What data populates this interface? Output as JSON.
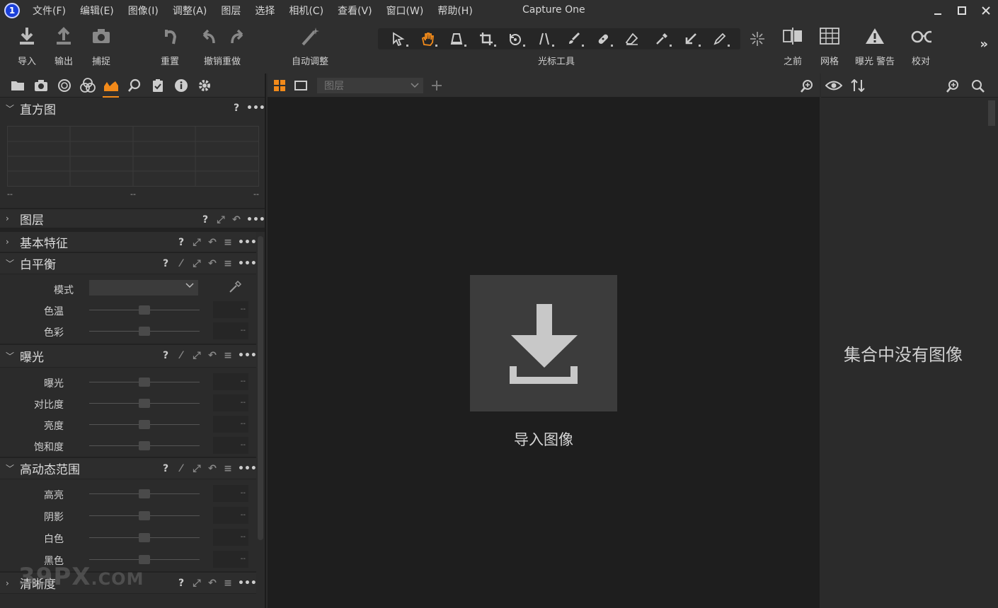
{
  "app": {
    "title": "Capture One",
    "logo_text": "1"
  },
  "menu": [
    "文件(F)",
    "编辑(E)",
    "图像(I)",
    "调整(A)",
    "图层",
    "选择",
    "相机(C)",
    "查看(V)",
    "窗口(W)",
    "帮助(H)"
  ],
  "toolbar": {
    "import": "导入",
    "export": "输出",
    "capture": "捕捉",
    "reset": "重置",
    "undo_redo": "撤销重做",
    "auto_adjust": "自动调整",
    "cursor_tools": "光标工具",
    "before": "之前",
    "grid": "网格",
    "exposure_warning": "曝光 警告",
    "proof": "校对",
    "more": "»"
  },
  "colors": {
    "accent": "#f28a1a",
    "background": "#2b2b2b",
    "viewer": "#1e1e1e"
  },
  "left": {
    "histogram": {
      "title": "直方图",
      "vals": [
        "--",
        "--",
        "--"
      ]
    },
    "layers": {
      "title": "图层"
    },
    "basic": {
      "title": "基本特征"
    },
    "white_balance": {
      "title": "白平衡",
      "mode_label": "模式",
      "rows": [
        {
          "label": "色温",
          "value": "--"
        },
        {
          "label": "色彩",
          "value": "--"
        }
      ]
    },
    "exposure": {
      "title": "曝光",
      "rows": [
        {
          "label": "曝光",
          "value": "--"
        },
        {
          "label": "对比度",
          "value": "--"
        },
        {
          "label": "亮度",
          "value": "--"
        },
        {
          "label": "饱和度",
          "value": "--"
        }
      ]
    },
    "hdr": {
      "title": "高动态范围",
      "rows": [
        {
          "label": "高亮",
          "value": "--"
        },
        {
          "label": "阴影",
          "value": "--"
        },
        {
          "label": "白色",
          "value": "--"
        },
        {
          "label": "黑色",
          "value": "--"
        }
      ]
    },
    "clarity": {
      "title": "清晰度"
    },
    "help": "?",
    "dots": "•••"
  },
  "viewer": {
    "layer_placeholder": "图层",
    "import_label": "导入图像"
  },
  "browser": {
    "empty": "集合中没有图像"
  },
  "watermark": {
    "main": "39PX",
    "suffix": ".COM"
  }
}
